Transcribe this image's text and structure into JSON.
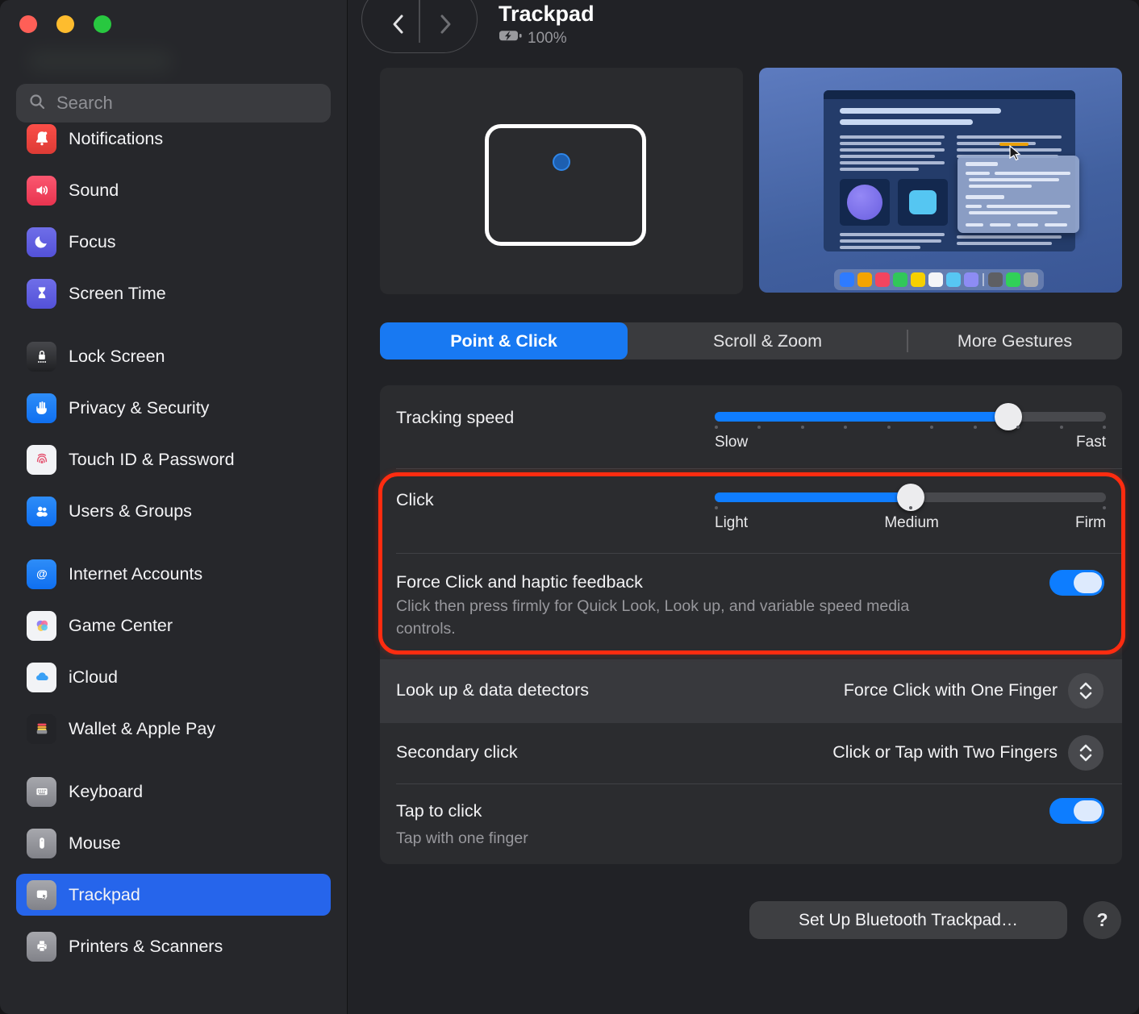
{
  "window": {
    "title": "Trackpad",
    "battery_percent": "100%"
  },
  "sidebar": {
    "search_placeholder": "Search",
    "selected_item": "Trackpad",
    "items": [
      {
        "label": "Notifications",
        "icon": "bell"
      },
      {
        "label": "Sound",
        "icon": "speaker"
      },
      {
        "label": "Focus",
        "icon": "moon"
      },
      {
        "label": "Screen Time",
        "icon": "hourglass"
      },
      {
        "label": "Lock Screen",
        "icon": "lock"
      },
      {
        "label": "Privacy & Security",
        "icon": "hand"
      },
      {
        "label": "Touch ID & Password",
        "icon": "fingerprint"
      },
      {
        "label": "Users & Groups",
        "icon": "users"
      },
      {
        "label": "Internet Accounts",
        "icon": "at-sign"
      },
      {
        "label": "Game Center",
        "icon": "game-bubbles"
      },
      {
        "label": "iCloud",
        "icon": "cloud"
      },
      {
        "label": "Wallet & Apple Pay",
        "icon": "wallet"
      },
      {
        "label": "Keyboard",
        "icon": "keyboard"
      },
      {
        "label": "Mouse",
        "icon": "mouse"
      },
      {
        "label": "Trackpad",
        "icon": "trackpad"
      },
      {
        "label": "Printers & Scanners",
        "icon": "printer"
      }
    ]
  },
  "tabs": [
    {
      "label": "Point & Click",
      "selected": true
    },
    {
      "label": "Scroll & Zoom",
      "selected": false
    },
    {
      "label": "More Gestures",
      "selected": false
    }
  ],
  "settings": {
    "tracking_speed": {
      "label": "Tracking speed",
      "slow_label": "Slow",
      "fast_label": "Fast",
      "value_pct": 75
    },
    "click": {
      "label": "Click",
      "light_label": "Light",
      "medium_label": "Medium",
      "firm_label": "Firm",
      "value_pct": 50
    },
    "force_click": {
      "label": "Force Click and haptic feedback",
      "description": "Click then press firmly for Quick Look, Look up, and variable speed media controls.",
      "enabled": true
    },
    "look_up": {
      "label": "Look up & data detectors",
      "value": "Force Click with One Finger"
    },
    "secondary_click": {
      "label": "Secondary click",
      "value": "Click or Tap with Two Fingers"
    },
    "tap_to_click": {
      "label": "Tap to click",
      "description": "Tap with one finger",
      "enabled": true
    }
  },
  "footer": {
    "setup_button_label": "Set Up Bluetooth Trackpad…",
    "help_label": "?"
  },
  "annotation": {
    "shape": "rounded-rectangle",
    "color": "#ff2c10",
    "highlights": "Click slider and Force Click and haptic feedback rows"
  },
  "colors": {
    "accent_blue": "#1879f2",
    "toggle_on": "#0d7dff",
    "selection_blue": "#2665eb",
    "annotation_red": "#ff2c10"
  }
}
